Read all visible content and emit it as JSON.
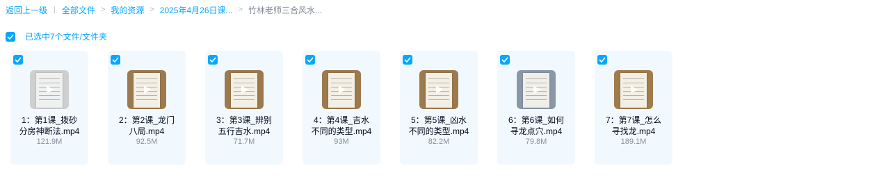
{
  "breadcrumb": {
    "back": "返回上一级",
    "all_files": "全部文件",
    "my_resources": "我的资源",
    "course_folder": "2025年4月26日课...",
    "current": "竹林老师三合风水..."
  },
  "selection": {
    "label": "已选中7个文件/文件夹",
    "checked": true
  },
  "colors": {
    "accent": "#06a7ff",
    "card_bg": "#f2f9fe",
    "size_text": "#878c9c"
  },
  "files": [
    {
      "name": "1：第1课_拨砂分房神断法.mp4",
      "size": "121.9M",
      "checked": true,
      "thumb": "play-video-icon"
    },
    {
      "name": "2：第2课_龙门八局.mp4",
      "size": "92.5M",
      "checked": true,
      "thumb": "play-video-icon"
    },
    {
      "name": "3：第3课_辨别五行吉水.mp4",
      "size": "71.7M",
      "checked": true,
      "thumb": "play-video-icon"
    },
    {
      "name": "4：第4课_吉水不同的类型.mp4",
      "size": "93M",
      "checked": true,
      "thumb": "play-video-icon"
    },
    {
      "name": "5：第5课_凶水不同的类型.mp4",
      "size": "82.2M",
      "checked": true,
      "thumb": "play-video-icon"
    },
    {
      "name": "6：第6课_如何寻龙点穴.mp4",
      "size": "79.8M",
      "checked": true,
      "thumb": "play-video-icon"
    },
    {
      "name": "7：第7课_怎么寻找龙.mp4",
      "size": "189.1M",
      "checked": true,
      "thumb": "play-video-icon"
    }
  ]
}
